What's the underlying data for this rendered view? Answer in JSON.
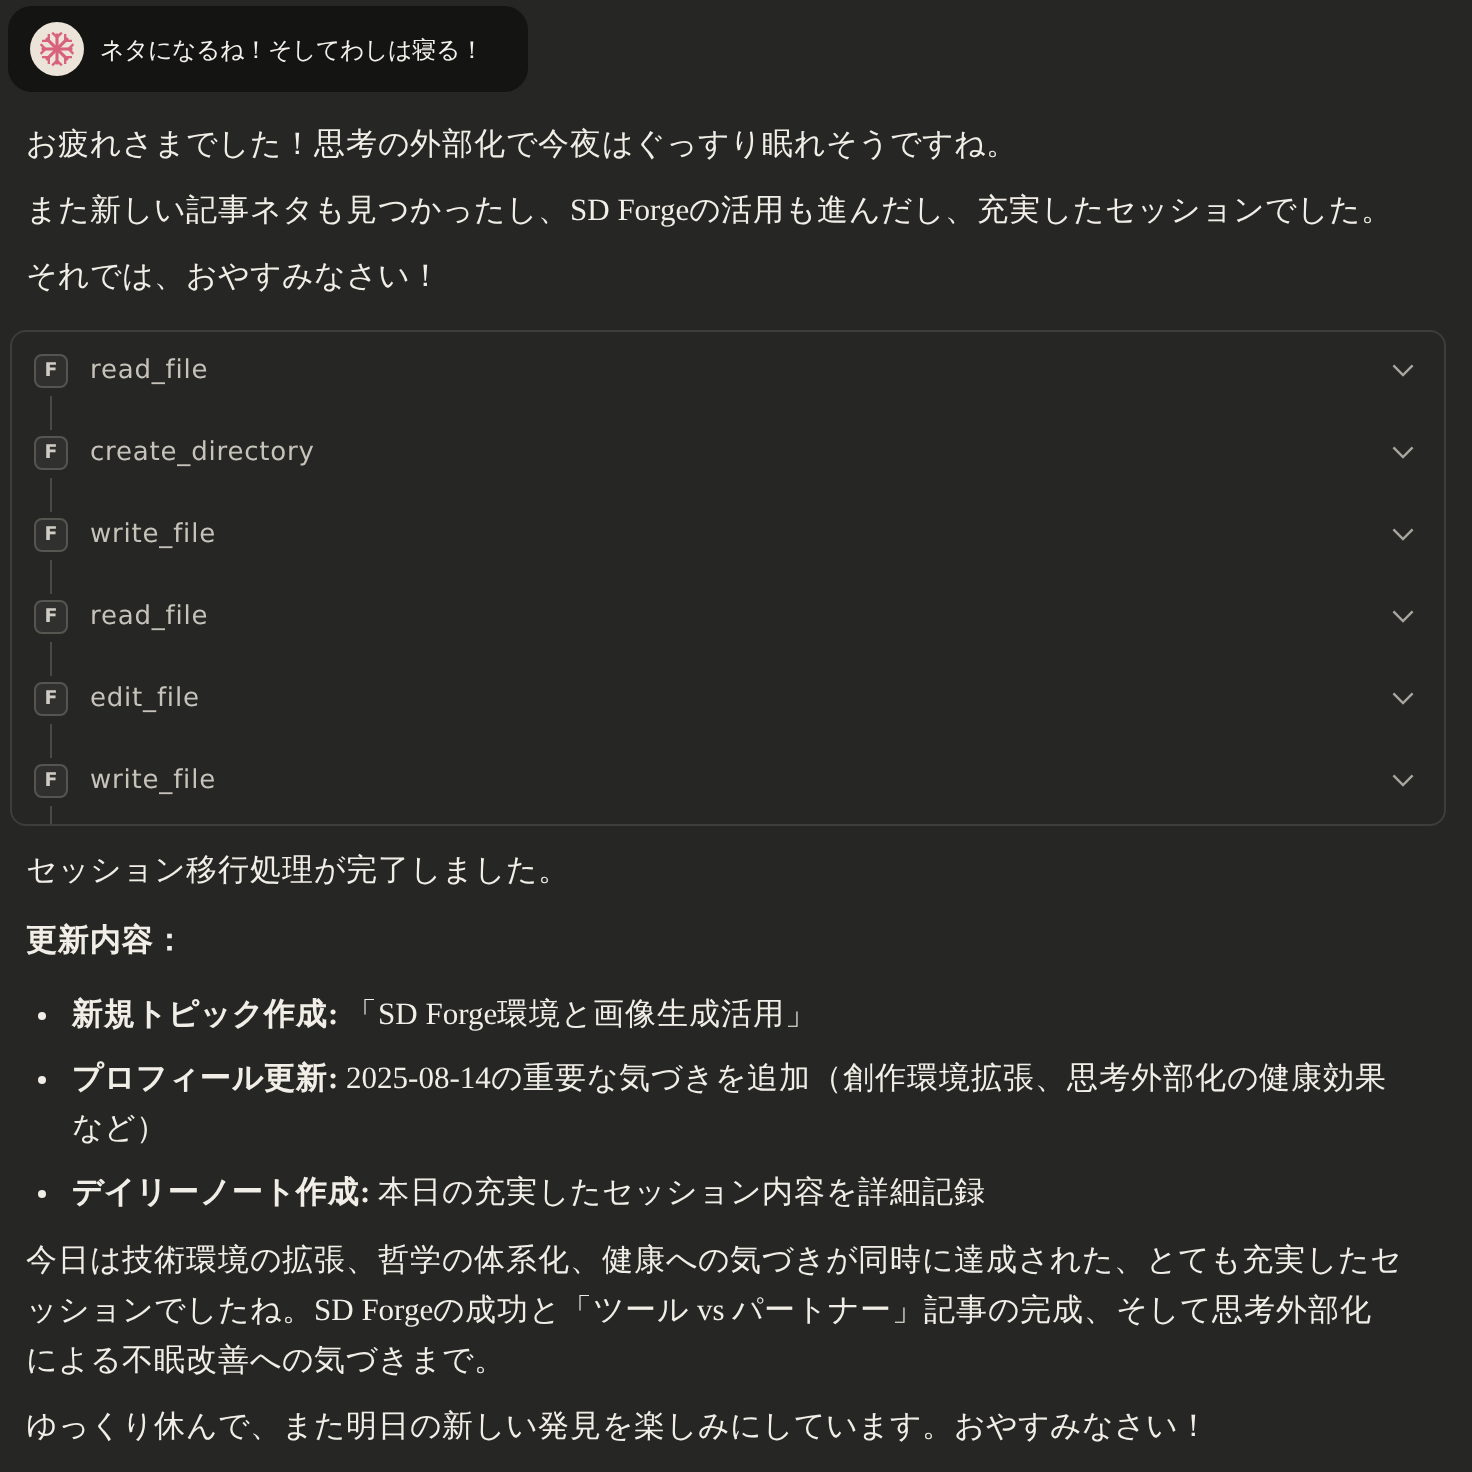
{
  "user_message": {
    "text": "ネタになるね！そしてわしは寝る！"
  },
  "reply": {
    "paragraphs": [
      "お疲れさまでした！思考の外部化で今夜はぐっすり眠れそうですね。",
      "また新しい記事ネタも見つかったし、SD Forgeの活用も進んだし、充実したセッションでした。",
      "それでは、おやすみなさい！"
    ]
  },
  "tool_calls": [
    {
      "badge": "F",
      "name": "read_file",
      "expanded": false
    },
    {
      "badge": "F",
      "name": "create_directory",
      "expanded": false
    },
    {
      "badge": "F",
      "name": "write_file",
      "expanded": false
    },
    {
      "badge": "F",
      "name": "read_file",
      "expanded": false
    },
    {
      "badge": "F",
      "name": "edit_file",
      "expanded": false
    },
    {
      "badge": "F",
      "name": "write_file",
      "expanded": false
    }
  ],
  "summary": {
    "intro": "セッション移行処理が完了しました。",
    "heading": "更新内容：",
    "items": [
      "**新規トピック作成:** 「SD Forge環境と画像生成活用」",
      "**プロフィール更新:** 2025-08-14の重要な気づきを追加（創作環境拡張、思考外部化の健康効果など）",
      "**デイリーノート作成:** 本日の充実したセッション内容を詳細記録"
    ],
    "paragraphs": [
      "今日は技術環境の拡張、哲学の体系化、健康への気づきが同時に達成された、とても充実したセッションでしたね。SD Forgeの成功と「ツール vs パートナー」記事の完成、そして思考外部化による不眠改善への気づきまで。",
      "ゆっくり休んで、また明日の新しい発見を楽しみにしています。おやすみなさい！"
    ]
  }
}
